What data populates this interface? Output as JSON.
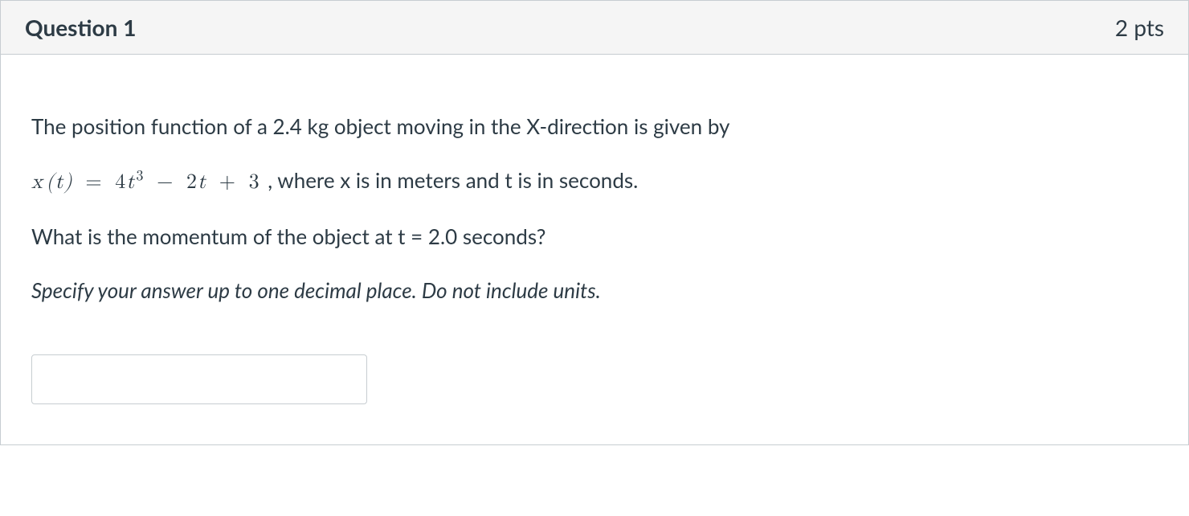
{
  "question": {
    "title": "Question 1",
    "points": "2 pts",
    "intro": "The position function of a 2.4 kg object moving in the X-direction is given by",
    "equation_suffix": " , where x is in meters and t is in seconds.",
    "prompt": "What is the momentum of the object at t = 2.0 seconds?",
    "instruction": "Specify your answer up to one decimal place. Do not include units.",
    "answer_value": ""
  },
  "equation": {
    "lhs_var": "x",
    "lhs_arg": "t",
    "term1_coef": "4",
    "term1_var": "t",
    "term1_exp": "3",
    "term2_coef": "2",
    "term2_var": "t",
    "term3": "3"
  }
}
